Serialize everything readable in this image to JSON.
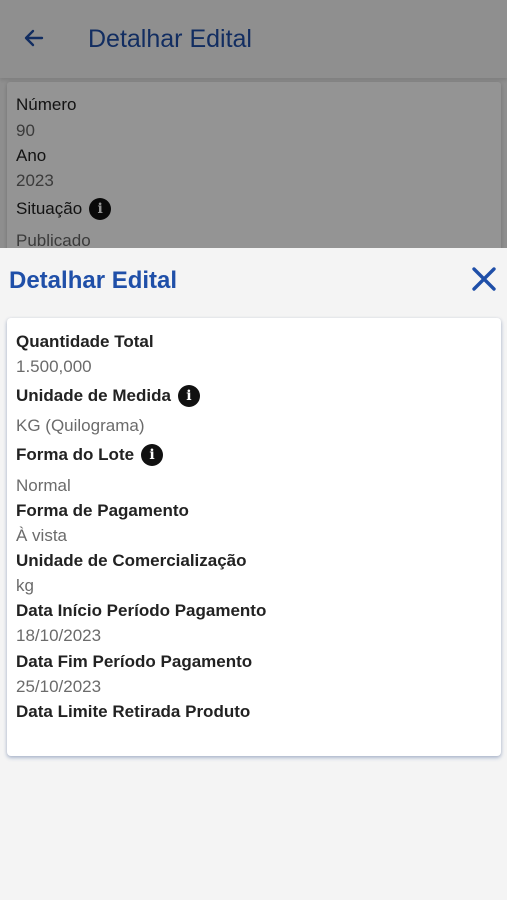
{
  "header": {
    "title": "Detalhar Edital"
  },
  "background_card": {
    "numero_label": "Número",
    "numero_value": "90",
    "ano_label": "Ano",
    "ano_value": "2023",
    "situacao_label": "Situação",
    "situacao_value": "Publicado"
  },
  "sheet": {
    "title": "Detalhar Edital",
    "fields": [
      {
        "label": "Quantidade Total",
        "value": "1.500,000"
      },
      {
        "label": "Unidade de Medida",
        "value": "KG (Quilograma)"
      },
      {
        "label": "Forma do Lote",
        "value": "Normal"
      },
      {
        "label": "Forma de Pagamento",
        "value": "À vista"
      },
      {
        "label": "Unidade de Comercialização",
        "value": "kg"
      },
      {
        "label": "Data Início Período Pagamento",
        "value": "18/10/2023"
      },
      {
        "label": "Data Fim Período Pagamento",
        "value": "25/10/2023"
      },
      {
        "label": "Data Limite Retirada Produto",
        "value": ""
      }
    ]
  },
  "colors": {
    "primary": "#1f4fa8",
    "label": "#222222",
    "value": "#6b6b6b"
  },
  "icons": {
    "back": "arrow-left",
    "close": "close-x",
    "info": "info-circle"
  }
}
